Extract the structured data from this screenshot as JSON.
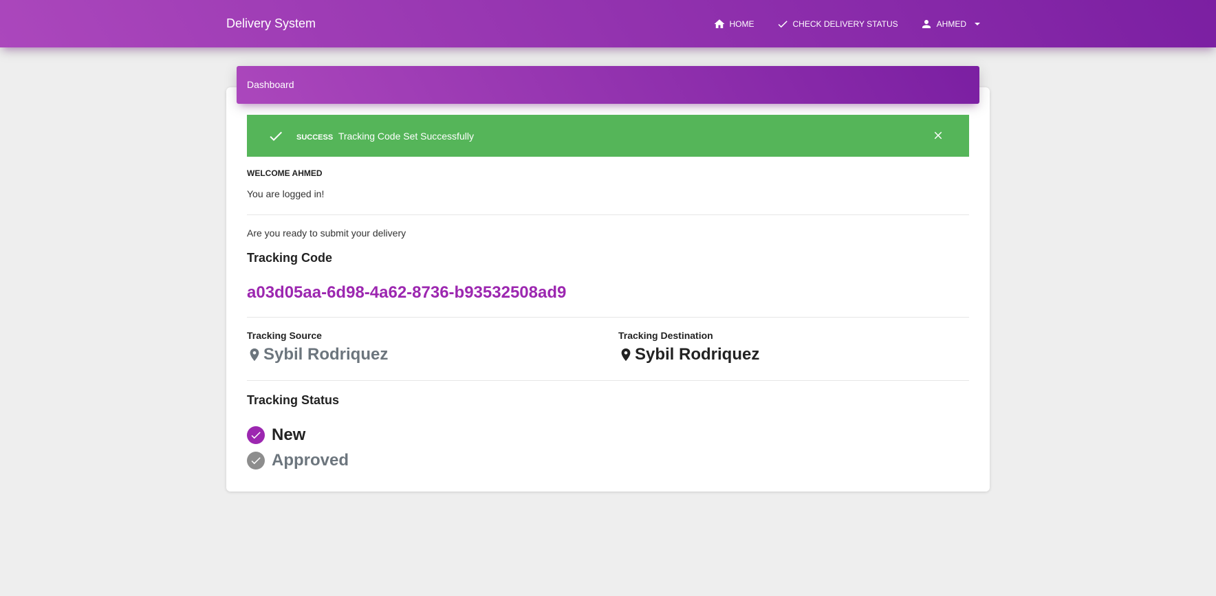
{
  "navbar": {
    "brand": "Delivery System",
    "links": [
      {
        "label": "HOME",
        "icon": "home-icon"
      },
      {
        "label": "CHECK DELIVERY STATUS",
        "icon": "check-icon"
      },
      {
        "label": "AHMED",
        "icon": "person-icon"
      }
    ]
  },
  "card": {
    "header": "Dashboard"
  },
  "alert": {
    "type": "SUCCESS",
    "message": "Tracking Code Set Successfully",
    "color": "#55b559"
  },
  "welcome": {
    "title": "WELCOME AHMED",
    "subtitle": "You are logged in!"
  },
  "delivery": {
    "prompt": "Are you ready to submit your delivery",
    "tracking_code_label": "Tracking Code",
    "tracking_code": "a03d05aa-6d98-4a62-8736-b93532508ad9",
    "source_label": "Tracking Source",
    "source": "Sybil Rodriquez",
    "destination_label": "Tracking Destination",
    "destination": "Sybil Rodriquez",
    "status_label": "Tracking Status",
    "statuses": [
      {
        "label": "New",
        "done": true,
        "color": "#9c27b0"
      },
      {
        "label": "Approved",
        "done": false,
        "color": "#8d8d8d"
      }
    ]
  },
  "colors": {
    "accent": "#9c27b0",
    "gradient_start": "#ab47bc",
    "gradient_end": "#7b1fa2",
    "success": "#55b559",
    "background": "#eeeeee"
  }
}
